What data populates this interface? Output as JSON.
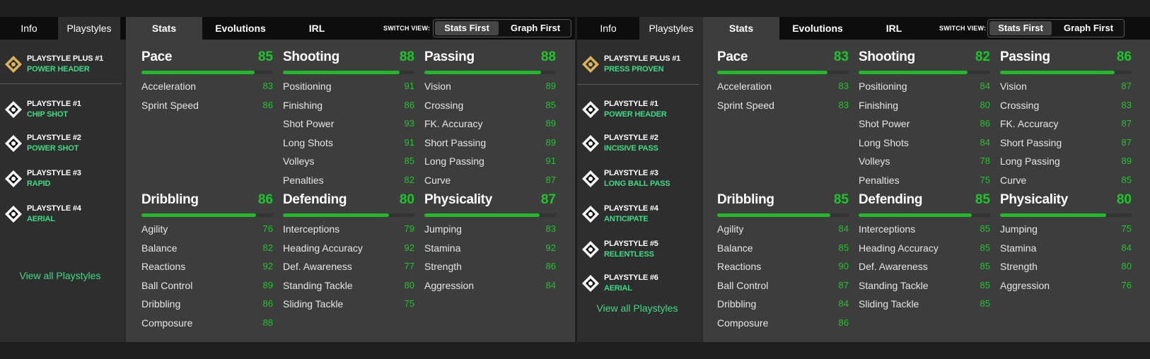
{
  "panels": [
    {
      "info_tabs": [
        "Info",
        "Playstyles"
      ],
      "top_tabs": [
        "Stats",
        "Evolutions",
        "IRL"
      ],
      "switch_view": {
        "label": "SWITCH VIEW:",
        "options": [
          "Stats First",
          "Graph First"
        ],
        "active": "Stats First"
      },
      "playstyles": [
        {
          "title": "PLAYSTYLE PLUS #1",
          "name": "POWER HEADER",
          "icon": "power-header-icon",
          "plus": true
        },
        {
          "title": "PLAYSTYLE #1",
          "name": "CHIP SHOT",
          "icon": "chip-shot-icon",
          "plus": false
        },
        {
          "title": "PLAYSTYLE #2",
          "name": "POWER SHOT",
          "icon": "power-shot-icon",
          "plus": false
        },
        {
          "title": "PLAYSTYLE #3",
          "name": "RAPID",
          "icon": "rapid-icon",
          "plus": false
        },
        {
          "title": "PLAYSTYLE #4",
          "name": "AERIAL",
          "icon": "aerial-icon",
          "plus": false
        }
      ],
      "view_all": "View all Playstyles",
      "categories": [
        {
          "name": "Pace",
          "value": 85,
          "stats": [
            {
              "name": "Acceleration",
              "value": 83
            },
            {
              "name": "Sprint Speed",
              "value": 86
            }
          ]
        },
        {
          "name": "Shooting",
          "value": 88,
          "stats": [
            {
              "name": "Positioning",
              "value": 91
            },
            {
              "name": "Finishing",
              "value": 86
            },
            {
              "name": "Shot Power",
              "value": 93
            },
            {
              "name": "Long Shots",
              "value": 91
            },
            {
              "name": "Volleys",
              "value": 85
            },
            {
              "name": "Penalties",
              "value": 82
            }
          ]
        },
        {
          "name": "Passing",
          "value": 88,
          "stats": [
            {
              "name": "Vision",
              "value": 89
            },
            {
              "name": "Crossing",
              "value": 85
            },
            {
              "name": "FK. Accuracy",
              "value": 89
            },
            {
              "name": "Short Passing",
              "value": 89
            },
            {
              "name": "Long Passing",
              "value": 91
            },
            {
              "name": "Curve",
              "value": 87
            }
          ]
        },
        {
          "name": "Dribbling",
          "value": 86,
          "stats": [
            {
              "name": "Agility",
              "value": 76
            },
            {
              "name": "Balance",
              "value": 82
            },
            {
              "name": "Reactions",
              "value": 92
            },
            {
              "name": "Ball Control",
              "value": 89
            },
            {
              "name": "Dribbling",
              "value": 86
            },
            {
              "name": "Composure",
              "value": 88
            }
          ]
        },
        {
          "name": "Defending",
          "value": 80,
          "stats": [
            {
              "name": "Interceptions",
              "value": 79
            },
            {
              "name": "Heading Accuracy",
              "value": 92
            },
            {
              "name": "Def. Awareness",
              "value": 77
            },
            {
              "name": "Standing Tackle",
              "value": 80
            },
            {
              "name": "Sliding Tackle",
              "value": 75
            }
          ]
        },
        {
          "name": "Physicality",
          "value": 87,
          "stats": [
            {
              "name": "Jumping",
              "value": 83
            },
            {
              "name": "Stamina",
              "value": 92
            },
            {
              "name": "Strength",
              "value": 86
            },
            {
              "name": "Aggression",
              "value": 84
            }
          ]
        }
      ]
    },
    {
      "info_tabs": [
        "Info",
        "Playstyles"
      ],
      "top_tabs": [
        "Stats",
        "Evolutions",
        "IRL"
      ],
      "switch_view": {
        "label": "SWITCH VIEW:",
        "options": [
          "Stats First",
          "Graph First"
        ],
        "active": "Stats First"
      },
      "playstyles": [
        {
          "title": "PLAYSTYLE PLUS #1",
          "name": "PRESS PROVEN",
          "icon": "press-proven-icon",
          "plus": true
        },
        {
          "title": "PLAYSTYLE #1",
          "name": "POWER HEADER",
          "icon": "power-header-icon",
          "plus": false
        },
        {
          "title": "PLAYSTYLE #2",
          "name": "INCISIVE PASS",
          "icon": "incisive-pass-icon",
          "plus": false
        },
        {
          "title": "PLAYSTYLE #3",
          "name": "LONG BALL PASS",
          "icon": "long-ball-pass-icon",
          "plus": false
        },
        {
          "title": "PLAYSTYLE #4",
          "name": "ANTICIPATE",
          "icon": "anticipate-icon",
          "plus": false
        },
        {
          "title": "PLAYSTYLE #5",
          "name": "RELENTLESS",
          "icon": "relentless-icon",
          "plus": false
        },
        {
          "title": "PLAYSTYLE #6",
          "name": "AERIAL",
          "icon": "aerial-icon",
          "plus": false
        }
      ],
      "view_all": "View all Playstyles",
      "categories": [
        {
          "name": "Pace",
          "value": 83,
          "stats": [
            {
              "name": "Acceleration",
              "value": 83
            },
            {
              "name": "Sprint Speed",
              "value": 83
            }
          ]
        },
        {
          "name": "Shooting",
          "value": 82,
          "stats": [
            {
              "name": "Positioning",
              "value": 84
            },
            {
              "name": "Finishing",
              "value": 80
            },
            {
              "name": "Shot Power",
              "value": 86
            },
            {
              "name": "Long Shots",
              "value": 84
            },
            {
              "name": "Volleys",
              "value": 78
            },
            {
              "name": "Penalties",
              "value": 75
            }
          ]
        },
        {
          "name": "Passing",
          "value": 86,
          "stats": [
            {
              "name": "Vision",
              "value": 87
            },
            {
              "name": "Crossing",
              "value": 83
            },
            {
              "name": "FK. Accuracy",
              "value": 87
            },
            {
              "name": "Short Passing",
              "value": 87
            },
            {
              "name": "Long Passing",
              "value": 89
            },
            {
              "name": "Curve",
              "value": 85
            }
          ]
        },
        {
          "name": "Dribbling",
          "value": 85,
          "stats": [
            {
              "name": "Agility",
              "value": 84
            },
            {
              "name": "Balance",
              "value": 85
            },
            {
              "name": "Reactions",
              "value": 90
            },
            {
              "name": "Ball Control",
              "value": 87
            },
            {
              "name": "Dribbling",
              "value": 84
            },
            {
              "name": "Composure",
              "value": 86
            }
          ]
        },
        {
          "name": "Defending",
          "value": 85,
          "stats": [
            {
              "name": "Interceptions",
              "value": 85
            },
            {
              "name": "Heading Accuracy",
              "value": 85
            },
            {
              "name": "Def. Awareness",
              "value": 85
            },
            {
              "name": "Standing Tackle",
              "value": 85
            },
            {
              "name": "Sliding Tackle",
              "value": 85
            }
          ]
        },
        {
          "name": "Physicality",
          "value": 80,
          "stats": [
            {
              "name": "Jumping",
              "value": 75
            },
            {
              "name": "Stamina",
              "value": 84
            },
            {
              "name": "Strength",
              "value": 80
            },
            {
              "name": "Aggression",
              "value": 76
            }
          ]
        }
      ]
    }
  ]
}
